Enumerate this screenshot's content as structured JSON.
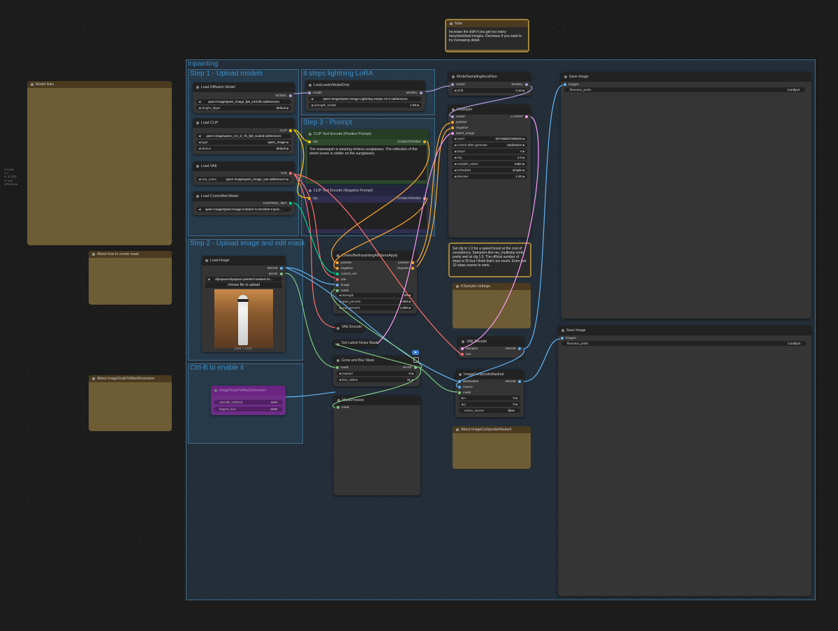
{
  "overlay_stats": [
    "T: 0.00s",
    "I: 0",
    "N: 37 [37]",
    "V: 148",
    "FPS:53.04"
  ],
  "groups": {
    "inpainting": "Inpainting",
    "step1": "Step 1 - Upload models",
    "lora": "4 steps lightning LoRA",
    "step3": "Step 3 - Prompt",
    "step2": "Step 2 - Upload image and edit mask",
    "ctrlb": "Ctrl-B to enable it"
  },
  "note_top": {
    "title": "Note",
    "text": "Increase the shift if you get too many blury/dark/bad images. Decrease if you want to try increasing detail."
  },
  "model_links": {
    "title": "Model links"
  },
  "about_mask": {
    "title": "About how to create mask"
  },
  "about_scale": {
    "title": "About ImageScaleToMaxDimension"
  },
  "load_diffusion": {
    "title": "Load Diffusion Model",
    "out": "MODEL",
    "w1": "qwen-image\\qwen_image_fp8_e4m3fn.safetensors",
    "w2l": "weight_dtype",
    "w2v": "default"
  },
  "load_clip": {
    "title": "Load CLIP",
    "out": "CLIP",
    "w1": "qwen-image\\qwen_2.5_vl_7b_fp8_scaled.safetensors",
    "w2l": "type",
    "w2v": "qwen_image",
    "w3l": "device",
    "w3v": "default"
  },
  "load_vae": {
    "title": "Load VAE",
    "out": "VAE",
    "w1l": "vae_name",
    "w1v": "qwen-image\\qwen_image_vae.safetensors"
  },
  "load_controlnet": {
    "title": "Load ControlNet Model",
    "out": "CONTROL_NET",
    "w1": "qwen-image\\Qwen-Image-InstantX-ControlNet-Inpain..."
  },
  "lora_loader": {
    "title": "LoraLoaderModelOnly",
    "in": "model",
    "out": "MODEL",
    "w1": "qwen-image\\Qwen-Image-Lightning-4steps-V2.0.safetensors",
    "w2l": "strength_model",
    "w2v": "1.00"
  },
  "clip_pos": {
    "title": "CLIP Text Encode (Positive Prompt)",
    "in": "clip",
    "out": "CONDITIONING",
    "text": "The mannequin is wearing rimless sunglasses. The reflection of the street scene is visible on the sunglasses."
  },
  "clip_neg": {
    "title": "CLIP Text Encode (Negative Prompt)",
    "in": "clip",
    "out": "CONDITIONING",
    "text": ""
  },
  "model_sampling": {
    "title": "ModelSamplingAuraFlow",
    "in": "model",
    "out": "MODEL",
    "w1l": "shift",
    "w1v": "3.10"
  },
  "ksampler": {
    "title": "KSampler",
    "inputs": [
      "model",
      "positive",
      "negative",
      "latent_image"
    ],
    "out": "LATENT",
    "widgets": [
      [
        "seed",
        "937165537295649"
      ],
      [
        "control after generate",
        "randomize"
      ],
      [
        "steps",
        "4"
      ],
      [
        "cfg",
        "1.0"
      ],
      [
        "sampler_name",
        "euler"
      ],
      [
        "scheduler",
        "simple"
      ],
      [
        "denoise",
        "1.00"
      ]
    ]
  },
  "note_cfg": {
    "text": "Set cfg to 1.0 for a speed boost at the cost of consistency. Samplers like res_multistep work pretty well at cfg 1.0. The official number of steps is 50 but I think that's too much. Even just 10 steps seems to work."
  },
  "ksampler_settings": {
    "title": "KSampler settings"
  },
  "save_image_1": {
    "title": "Save Image",
    "in": "images",
    "w1l": "filename_prefix",
    "w1v": "ComfyUI"
  },
  "save_image_2": {
    "title": "Save Image",
    "in": "images",
    "w1l": "filename_prefix",
    "w1v": "ComfyUI"
  },
  "load_image": {
    "title": "Load Image",
    "outs": [
      "IMAGE",
      "MASK"
    ],
    "w1": "clipspace/clipspace-painted-masked-34...",
    "btn": "choose file to upload",
    "size": "1328 × 1328"
  },
  "controlnet_apply": {
    "title": "ControlNetInpaintingAliMamaApply",
    "inputs": [
      "positive",
      "negative",
      "control_net",
      "vae",
      "image",
      "mask"
    ],
    "outs": [
      "positive",
      "negative"
    ],
    "widgets": [
      [
        "strength",
        "1.00"
      ],
      [
        "start_percent",
        "0.000"
      ],
      [
        "end_percent",
        "1.000"
      ]
    ]
  },
  "vae_encode": {
    "title": "VAE Encode"
  },
  "set_latent": {
    "title": "Set Latent Noise Mask"
  },
  "grow_blur": {
    "title": "Grow and Blur Mask",
    "in": "mask",
    "out": "MASK",
    "widgets": [
      [
        "expand",
        "0"
      ],
      [
        "blur_radius",
        "31"
      ]
    ]
  },
  "mask_preview": {
    "title": "MaskPreview",
    "in": "mask"
  },
  "vae_decode": {
    "title": "VAE Decode",
    "inputs": [
      "samples",
      "vae"
    ],
    "out": "IMAGE"
  },
  "image_composite": {
    "title": "ImageCompositeMasked",
    "inputs": [
      "destination",
      "source",
      "mask"
    ],
    "out": "IMAGE",
    "widgets": [
      [
        "x",
        "0"
      ],
      [
        "y",
        "0"
      ],
      [
        "resize_source",
        "false"
      ]
    ]
  },
  "about_composite": {
    "title": "About ImageCompositeMasked"
  },
  "bypassed": {
    "title": "ImageScaleToMaxDimension",
    "w1l": "upscale_method",
    "w1v": "area",
    "w2l": "largest_size",
    "w2v": "1536"
  },
  "colors": {
    "model": "#b39ddb",
    "clip": "#ffd500",
    "vae": "#ff6e6e",
    "conditioning": "#ffa931",
    "latent": "#ff9cf9",
    "image": "#64b5f6",
    "mask": "#81c784",
    "control_net": "#00d78d"
  }
}
